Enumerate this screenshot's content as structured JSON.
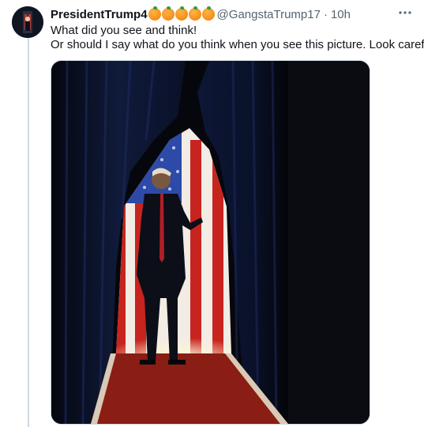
{
  "tweet": {
    "display_name": "PresidentTrump4",
    "badge_emojis": [
      "orange-emoji",
      "orange-emoji",
      "orange-emoji",
      "orange-emoji",
      "orange-emoji"
    ],
    "handle": "@GangstaTrump17",
    "separator": "·",
    "time": "10h",
    "more_icon": "more-horizontal-icon",
    "text_lines": [
      "What did you see and think!",
      "Or should I say what do you think when you see this picture. Look carefully"
    ]
  },
  "colors": {
    "text_primary": "#0f1419",
    "text_secondary": "#536471",
    "thread_line": "#cfd9de"
  }
}
